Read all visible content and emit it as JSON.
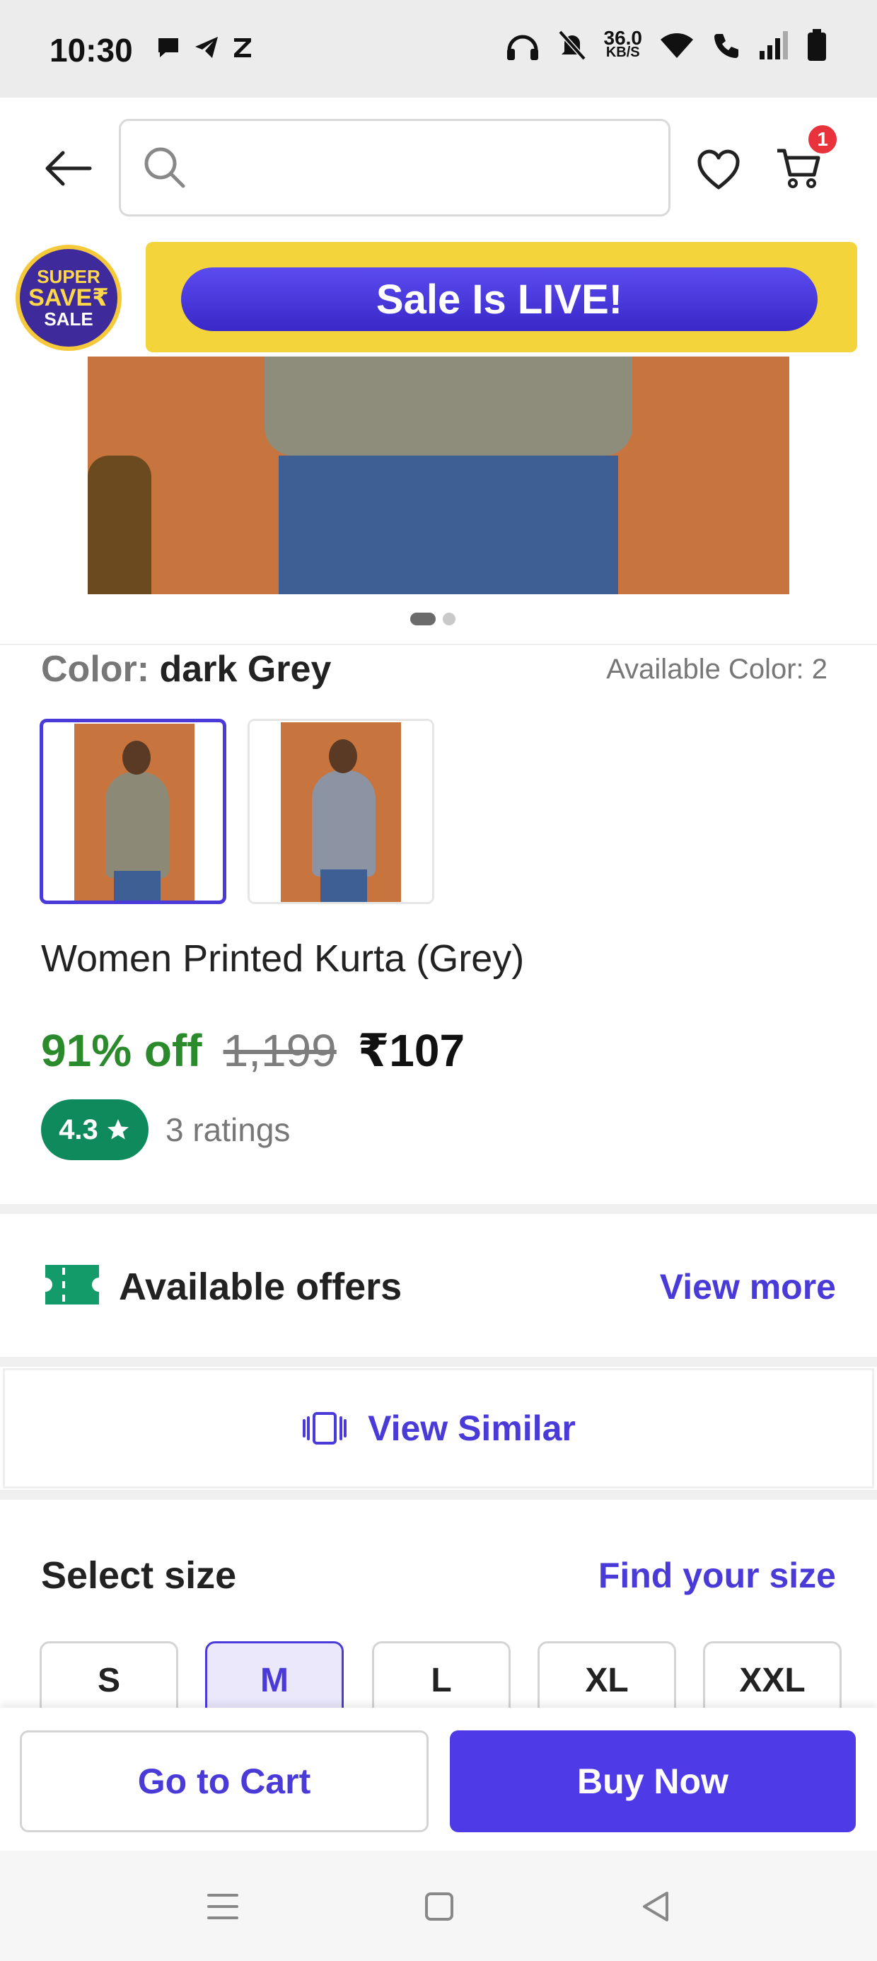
{
  "status_bar": {
    "time": "10:30",
    "left_icons": [
      "chat-bubble-icon",
      "telegram-icon",
      "z-app-icon"
    ],
    "net_speed_value": "36.0",
    "net_speed_unit": "KB/S",
    "right_icons": [
      "headphones-icon",
      "bell-muted-icon",
      "wifi-icon",
      "wifi-call-icon",
      "signal-icon",
      "battery-icon"
    ]
  },
  "header": {
    "search_placeholder": "",
    "cart_count": "1"
  },
  "sale_banner": {
    "badge_line1": "SUPER",
    "badge_line2": "SAVE₹",
    "badge_line3": "SALE",
    "headline": "Sale Is LIVE!"
  },
  "gallery": {
    "page_count": 2,
    "active_index": 0
  },
  "color": {
    "label": "Color:",
    "value": "dark Grey",
    "available": "Available Color: 2"
  },
  "product": {
    "title": "Women Printed Kurta (Grey)",
    "discount": "91% off",
    "mrp": "1,199",
    "price": "₹107",
    "rating": "4.3",
    "ratings_count": "3 ratings"
  },
  "offers": {
    "title": "Available offers",
    "link": "View more"
  },
  "view_similar": {
    "label": "View Similar"
  },
  "size": {
    "title": "Select size",
    "link": "Find your size",
    "options": [
      "S",
      "M",
      "L",
      "XL",
      "XXL"
    ],
    "selected": "M"
  },
  "actions": {
    "cart": "Go to Cart",
    "buy": "Buy Now"
  },
  "colors": {
    "accent": "#4a3bd9",
    "discount_green": "#2b8a2b",
    "rating_green": "#0f8a5c",
    "sale_yellow": "#f3d53b"
  }
}
